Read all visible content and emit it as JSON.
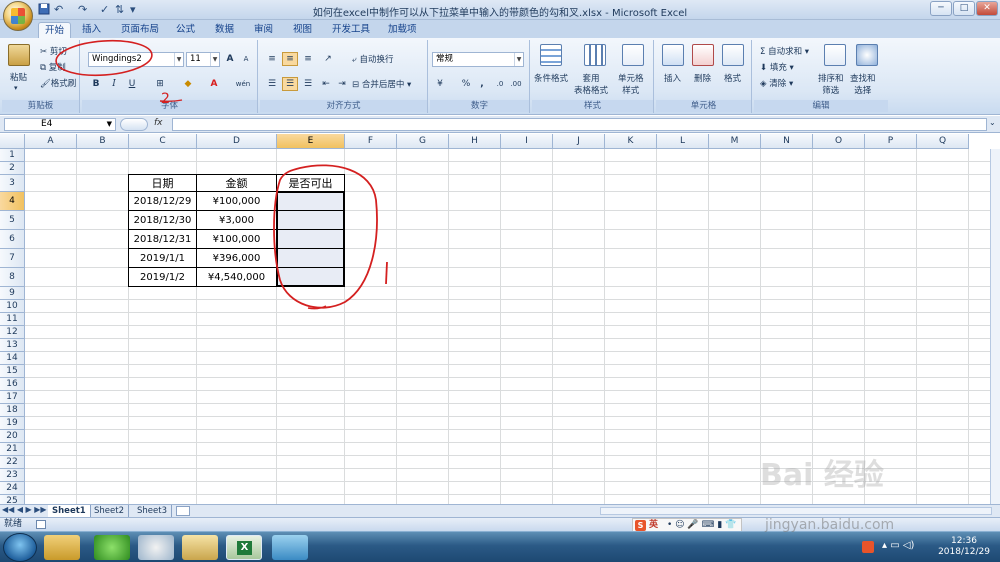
{
  "window": {
    "title": "如何在excel中制作可以从下拉菜单中输入的带颜色的勾和叉.xlsx - Microsoft Excel",
    "minimize": "─",
    "maximize": "□",
    "close": "✕"
  },
  "tabs": [
    "开始",
    "插入",
    "页面布局",
    "公式",
    "数据",
    "审阅",
    "视图",
    "开发工具",
    "加载项"
  ],
  "ribbon": {
    "clipboard": {
      "paste": "粘贴",
      "cut": "剪切",
      "copy": "复制",
      "format_painter": "格式刷",
      "label": "剪贴板"
    },
    "font": {
      "name": "Wingdings2",
      "size": "11",
      "bold": "B",
      "italic": "I",
      "underline": "U",
      "font_color": "A",
      "phonetic": "wén",
      "label": "字体",
      "grow": "A",
      "shrink": "A"
    },
    "alignment": {
      "wrap": "自动换行",
      "merge": "合并后居中",
      "label": "对齐方式"
    },
    "number": {
      "format": "常规",
      "percent": "%",
      "comma": ",",
      "label": "数字"
    },
    "styles": {
      "conditional": "条件格式",
      "table": "套用\n表格格式",
      "cell_styles": "单元格\n样式",
      "label": "样式"
    },
    "cells": {
      "insert": "插入",
      "delete": "删除",
      "format": "格式",
      "label": "单元格"
    },
    "editing": {
      "autosum": "自动求和",
      "fill": "填充",
      "clear": "清除",
      "sort": "排序和\n筛选",
      "find": "查找和\n选择",
      "label": "编辑"
    }
  },
  "formula_bar": {
    "name_box": "E4",
    "fx": "fx",
    "value": ""
  },
  "columns": [
    "A",
    "B",
    "C",
    "D",
    "E",
    "F",
    "G",
    "H",
    "I",
    "J",
    "K",
    "L",
    "M",
    "N",
    "O",
    "P",
    "Q"
  ],
  "rows": [
    "1",
    "2",
    "3",
    "4",
    "5",
    "6",
    "7",
    "8",
    "9",
    "10",
    "11",
    "12",
    "13",
    "14",
    "15",
    "16",
    "17",
    "18",
    "19",
    "20",
    "21",
    "22",
    "23",
    "24",
    "25"
  ],
  "table": {
    "headers": [
      "日期",
      "金额",
      "是否可出"
    ],
    "rows": [
      [
        "2018/12/29",
        "¥100,000",
        ""
      ],
      [
        "2018/12/30",
        "¥3,000",
        ""
      ],
      [
        "2018/12/31",
        "¥100,000",
        ""
      ],
      [
        "2019/1/1",
        "¥396,000",
        ""
      ],
      [
        "2019/1/2",
        "¥4,540,000",
        ""
      ]
    ]
  },
  "sheets": [
    "Sheet1",
    "Sheet2",
    "Sheet3"
  ],
  "status": {
    "ready": "就绪"
  },
  "tray": {
    "ime": "英",
    "time": "12:36",
    "date": "2018/12/29"
  },
  "annotation": {
    "number": "2"
  },
  "watermark": {
    "brand": "Bai 经验",
    "site": "jingyan.baidu.com"
  },
  "colors": {
    "selection": "#f1c15f",
    "annotation": "#d42020",
    "ribbon": "#dbe7f5",
    "cell_fill": "#e8ecf5"
  }
}
